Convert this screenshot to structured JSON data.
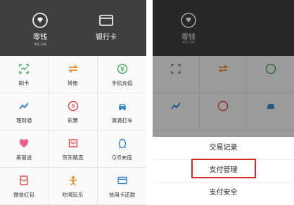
{
  "header": {
    "change": {
      "label": "零钱",
      "balance": "¥6.04",
      "icon": "wallet-diamond-icon"
    },
    "bank_card": {
      "label": "银行卡",
      "icon": "card-icon"
    }
  },
  "grid": [
    {
      "label": "刷卡",
      "icon": "scan-icon",
      "color": "#2aa845"
    },
    {
      "label": "转账",
      "icon": "transfer-icon",
      "color": "#f08c2c"
    },
    {
      "label": "手机充值",
      "icon": "phone-recharge-icon",
      "color": "#2aa845"
    },
    {
      "label": "理财通",
      "icon": "trend-icon",
      "color": "#2f7fd3"
    },
    {
      "label": "彩票",
      "icon": "lottery-icon",
      "color": "#e84545"
    },
    {
      "label": "滴滴打车",
      "icon": "car-icon",
      "color": "#3b8fd9"
    },
    {
      "label": "美丽说",
      "icon": "heart-icon",
      "color": "#ef5b8a"
    },
    {
      "label": "京东精选",
      "icon": "shop-bag-icon",
      "color": "#e84545"
    },
    {
      "label": "Q币充值",
      "icon": "penguin-icon",
      "color": "#2f7fd3"
    },
    {
      "label": "微信红包",
      "icon": "red-packet-icon",
      "color": "#e84545"
    },
    {
      "label": "吃喝玩乐",
      "icon": "party-icon",
      "color": "#f08c2c"
    },
    {
      "label": "信用卡还款",
      "icon": "credit-card-icon",
      "color": "#2f7fd3"
    }
  ],
  "action_sheet": {
    "items": [
      "交易记录",
      "支付管理",
      "支付安全"
    ],
    "highlighted": "支付管理",
    "highlight_color": "#d42b2b"
  }
}
